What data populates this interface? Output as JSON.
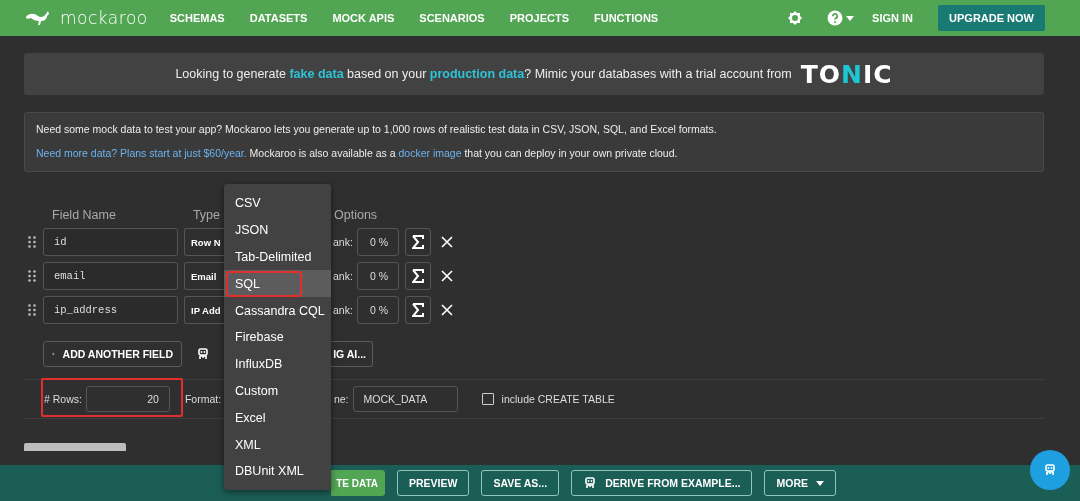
{
  "nav": {
    "logo": "mockaroo",
    "links": [
      "SCHEMAS",
      "DATASETS",
      "MOCK APIS",
      "SCENARIOS",
      "PROJECTS",
      "FUNCTIONS"
    ],
    "sign_in": "SIGN IN",
    "upgrade": "UPGRADE NOW"
  },
  "banner": {
    "segments": [
      {
        "text": "Looking to generate ",
        "kind": "plain"
      },
      {
        "text": "fake data",
        "kind": "highlight"
      },
      {
        "text": " based on your ",
        "kind": "plain"
      },
      {
        "text": "production data",
        "kind": "highlight"
      },
      {
        "text": "? Mimic your databases with a trial account from",
        "kind": "plain"
      }
    ],
    "logo_parts": [
      {
        "text": "TO",
        "accent": false
      },
      {
        "text": "N",
        "accent": true
      },
      {
        "text": "IC",
        "accent": false
      }
    ]
  },
  "info": {
    "lines": [
      [
        {
          "text": "Need some mock data to test your app? Mockaroo lets you generate up to 1,000 rows of realistic test data in CSV, JSON, SQL, and Excel formats.",
          "kind": "plain"
        }
      ],
      [
        {
          "text": "Need more data? Plans start at just $60/year.",
          "kind": "link"
        },
        {
          "text": " Mockaroo is also available as a ",
          "kind": "plain"
        },
        {
          "text": "docker image",
          "kind": "link"
        },
        {
          "text": " that you can deploy in your own private cloud.",
          "kind": "plain"
        }
      ]
    ]
  },
  "schema": {
    "headers": [
      "Field Name",
      "Type",
      "Options"
    ],
    "fields": [
      {
        "name": "id",
        "type": "Row N",
        "blank_label": "ank:",
        "blank": "0 %"
      },
      {
        "name": "email",
        "type": "Email",
        "blank_label": "ank:",
        "blank": "0 %"
      },
      {
        "name": "ip_address",
        "type": "IP Add",
        "blank_label": "ank:",
        "blank": "0 %"
      }
    ],
    "add_button": "ADD ANOTHER FIELD",
    "ai_button": "IG AI..."
  },
  "settings": {
    "rows_label": "# Rows:",
    "rows": "20",
    "rows_highlighted": true,
    "format_label": "Format:",
    "table_label": "ne:",
    "table_name": "MOCK_DATA",
    "include_create_table": {
      "label": "include CREATE TABLE",
      "checked": false
    }
  },
  "format_menu": {
    "items": [
      {
        "label": "CSV",
        "selected": false,
        "highlighted": false
      },
      {
        "label": "JSON",
        "selected": false,
        "highlighted": false
      },
      {
        "label": "Tab-Delimited",
        "selected": false,
        "highlighted": false
      },
      {
        "label": "SQL",
        "selected": true,
        "highlighted": true
      },
      {
        "label": "Cassandra CQL",
        "selected": false,
        "highlighted": false
      },
      {
        "label": "Firebase",
        "selected": false,
        "highlighted": false
      },
      {
        "label": "InfluxDB",
        "selected": false,
        "highlighted": false
      },
      {
        "label": "Custom",
        "selected": false,
        "highlighted": false
      },
      {
        "label": "Excel",
        "selected": false,
        "highlighted": false
      },
      {
        "label": "XML",
        "selected": false,
        "highlighted": false
      },
      {
        "label": "DBUnit XML",
        "selected": false,
        "highlighted": false
      }
    ]
  },
  "footer": {
    "buttons": [
      {
        "label": "TE DATA",
        "kind": "primary"
      },
      {
        "label": "PREVIEW",
        "kind": "outline"
      },
      {
        "label": "SAVE AS...",
        "kind": "outline"
      },
      {
        "label": "DERIVE FROM EXAMPLE...",
        "kind": "robot"
      },
      {
        "label": "MORE",
        "kind": "caret"
      }
    ]
  }
}
